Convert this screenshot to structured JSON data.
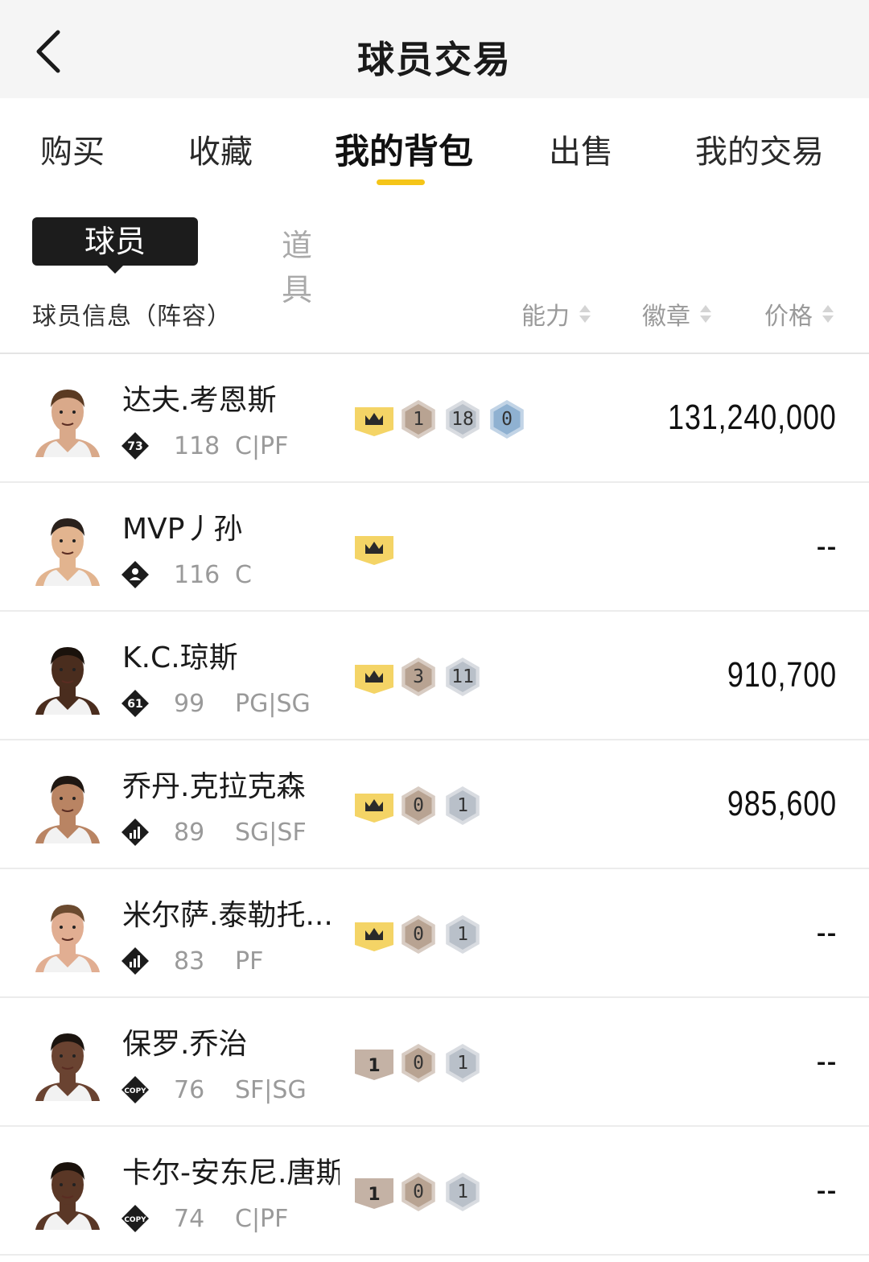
{
  "header": {
    "title": "球员交易",
    "back_icon": "back-chevron-icon"
  },
  "tabs": [
    "购买",
    "收藏",
    "我的背包",
    "出售",
    "我的交易"
  ],
  "sub_tabs": {
    "active": "球员",
    "inactive": "道具"
  },
  "columns": {
    "info": "球员信息（阵容）",
    "ability": "能力",
    "badge": "徽章",
    "price": "价格"
  },
  "colors": {
    "accent": "#f5c518",
    "crown_bg": "#f4d466",
    "bronze": "#b8a392",
    "silver": "#b9c0c9",
    "blue": "#8fb1d1"
  },
  "players": [
    {
      "name": "达夫.考恩斯",
      "icon": "73",
      "rating": "118",
      "position": "C|PF",
      "badges": [
        {
          "type": "crown",
          "text": ""
        },
        {
          "type": "bronze",
          "text": "1"
        },
        {
          "type": "silver",
          "text": "18"
        },
        {
          "type": "blue",
          "text": "0"
        }
      ],
      "price": "131,240,000",
      "skin": "#d9a98a",
      "hair": "#5a3a22"
    },
    {
      "name": "MVP丿孙",
      "icon": "person",
      "rating": "116",
      "position": "C",
      "badges": [
        {
          "type": "crown",
          "text": ""
        }
      ],
      "price": "--",
      "skin": "#e2b48f",
      "hair": "#2a211c"
    },
    {
      "name": "K.C.琼斯",
      "icon": "61",
      "rating": "99",
      "position": "PG|SG",
      "badges": [
        {
          "type": "crown",
          "text": ""
        },
        {
          "type": "bronze",
          "text": "3"
        },
        {
          "type": "silver",
          "text": "11"
        }
      ],
      "price": "910,700",
      "skin": "#4a2d1e",
      "hair": "#1a120c"
    },
    {
      "name": "乔丹.克拉克森",
      "icon": "bars",
      "rating": "89",
      "position": "SG|SF",
      "badges": [
        {
          "type": "crown",
          "text": ""
        },
        {
          "type": "bronze",
          "text": "0"
        },
        {
          "type": "silver",
          "text": "1"
        }
      ],
      "price": "985,600",
      "skin": "#b98463",
      "hair": "#1f1712"
    },
    {
      "name": "米尔萨.泰勒托...",
      "icon": "bars",
      "rating": "83",
      "position": "PF",
      "badges": [
        {
          "type": "crown",
          "text": ""
        },
        {
          "type": "bronze",
          "text": "0"
        },
        {
          "type": "silver",
          "text": "1"
        }
      ],
      "price": "--",
      "skin": "#e1ae92",
      "hair": "#6b4a2f"
    },
    {
      "name": "保罗.乔治",
      "icon": "COPY",
      "rating": "76",
      "position": "SF|SG",
      "badges": [
        {
          "type": "tag",
          "text": "1"
        },
        {
          "type": "bronze",
          "text": "0"
        },
        {
          "type": "silver",
          "text": "1"
        }
      ],
      "price": "--",
      "skin": "#6a4331",
      "hair": "#1b140f"
    },
    {
      "name": "卡尔-安东尼.唐斯",
      "icon": "COPY",
      "rating": "74",
      "position": "C|PF",
      "badges": [
        {
          "type": "tag",
          "text": "1"
        },
        {
          "type": "bronze",
          "text": "0"
        },
        {
          "type": "silver",
          "text": "1"
        }
      ],
      "price": "--",
      "skin": "#5a3726",
      "hair": "#1a120c"
    }
  ]
}
